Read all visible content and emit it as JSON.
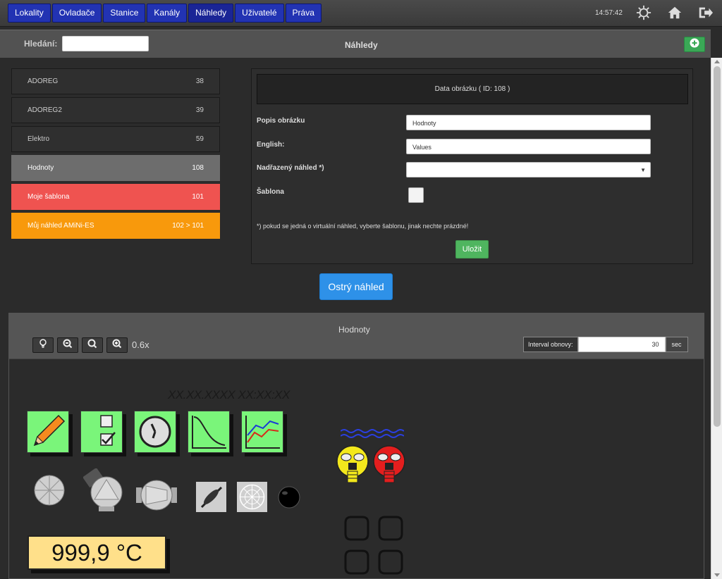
{
  "nav": {
    "items": [
      "Lokality",
      "Ovladače",
      "Stanice",
      "Kanály",
      "Náhledy",
      "Uživatelé",
      "Práva"
    ],
    "active": "Náhledy",
    "clock": "14:57:42",
    "icons": [
      "gear-icon",
      "home-icon",
      "logout-icon"
    ]
  },
  "header": {
    "search_label": "Hledání:",
    "search_value": "",
    "title": "Náhledy",
    "add_icon": "plus-circle-icon"
  },
  "list": [
    {
      "name": "ADOREG",
      "id": "38",
      "style": "default"
    },
    {
      "name": "ADOREG2",
      "id": "39",
      "style": "default"
    },
    {
      "name": "Elektro",
      "id": "59",
      "style": "default"
    },
    {
      "name": "Hodnoty",
      "id": "108",
      "style": "gray"
    },
    {
      "name": "Moje šablona",
      "id": "101",
      "style": "red"
    },
    {
      "name": "Můj náhled AMiNi-ES",
      "id": "102 > 101",
      "style": "orange"
    }
  ],
  "form": {
    "header": "Data obrázku ( ID: 108 )",
    "popis_label": "Popis obrázku",
    "popis_value": "Hodnoty",
    "english_label": "English:",
    "english_value": "Values",
    "parent_label": "Nadřazený náhled *)",
    "parent_value": "",
    "template_label": "Šablona",
    "template_checked": false,
    "note": "*) pokud se jedná o virtuální náhled, vyberte šablonu, jinak nechte prázdné!",
    "save_label": "Uložit"
  },
  "live_preview_label": "Ostrý náhled",
  "preview": {
    "title": "Hodnoty",
    "zoom": "0.6x",
    "interval_label": "Interval obnovy:",
    "interval_value": "30",
    "interval_unit": "sec",
    "datetime": "XX.XX.XXXX XX:XX:XX",
    "temperature": "999,9 °C"
  },
  "colors": {
    "nav_bg": "#2233b3",
    "accent_green": "#4fb55f",
    "accent_blue": "#2e91e8",
    "item_red": "#ef5350",
    "item_orange": "#f8990c",
    "tile_green": "#7af57a"
  }
}
